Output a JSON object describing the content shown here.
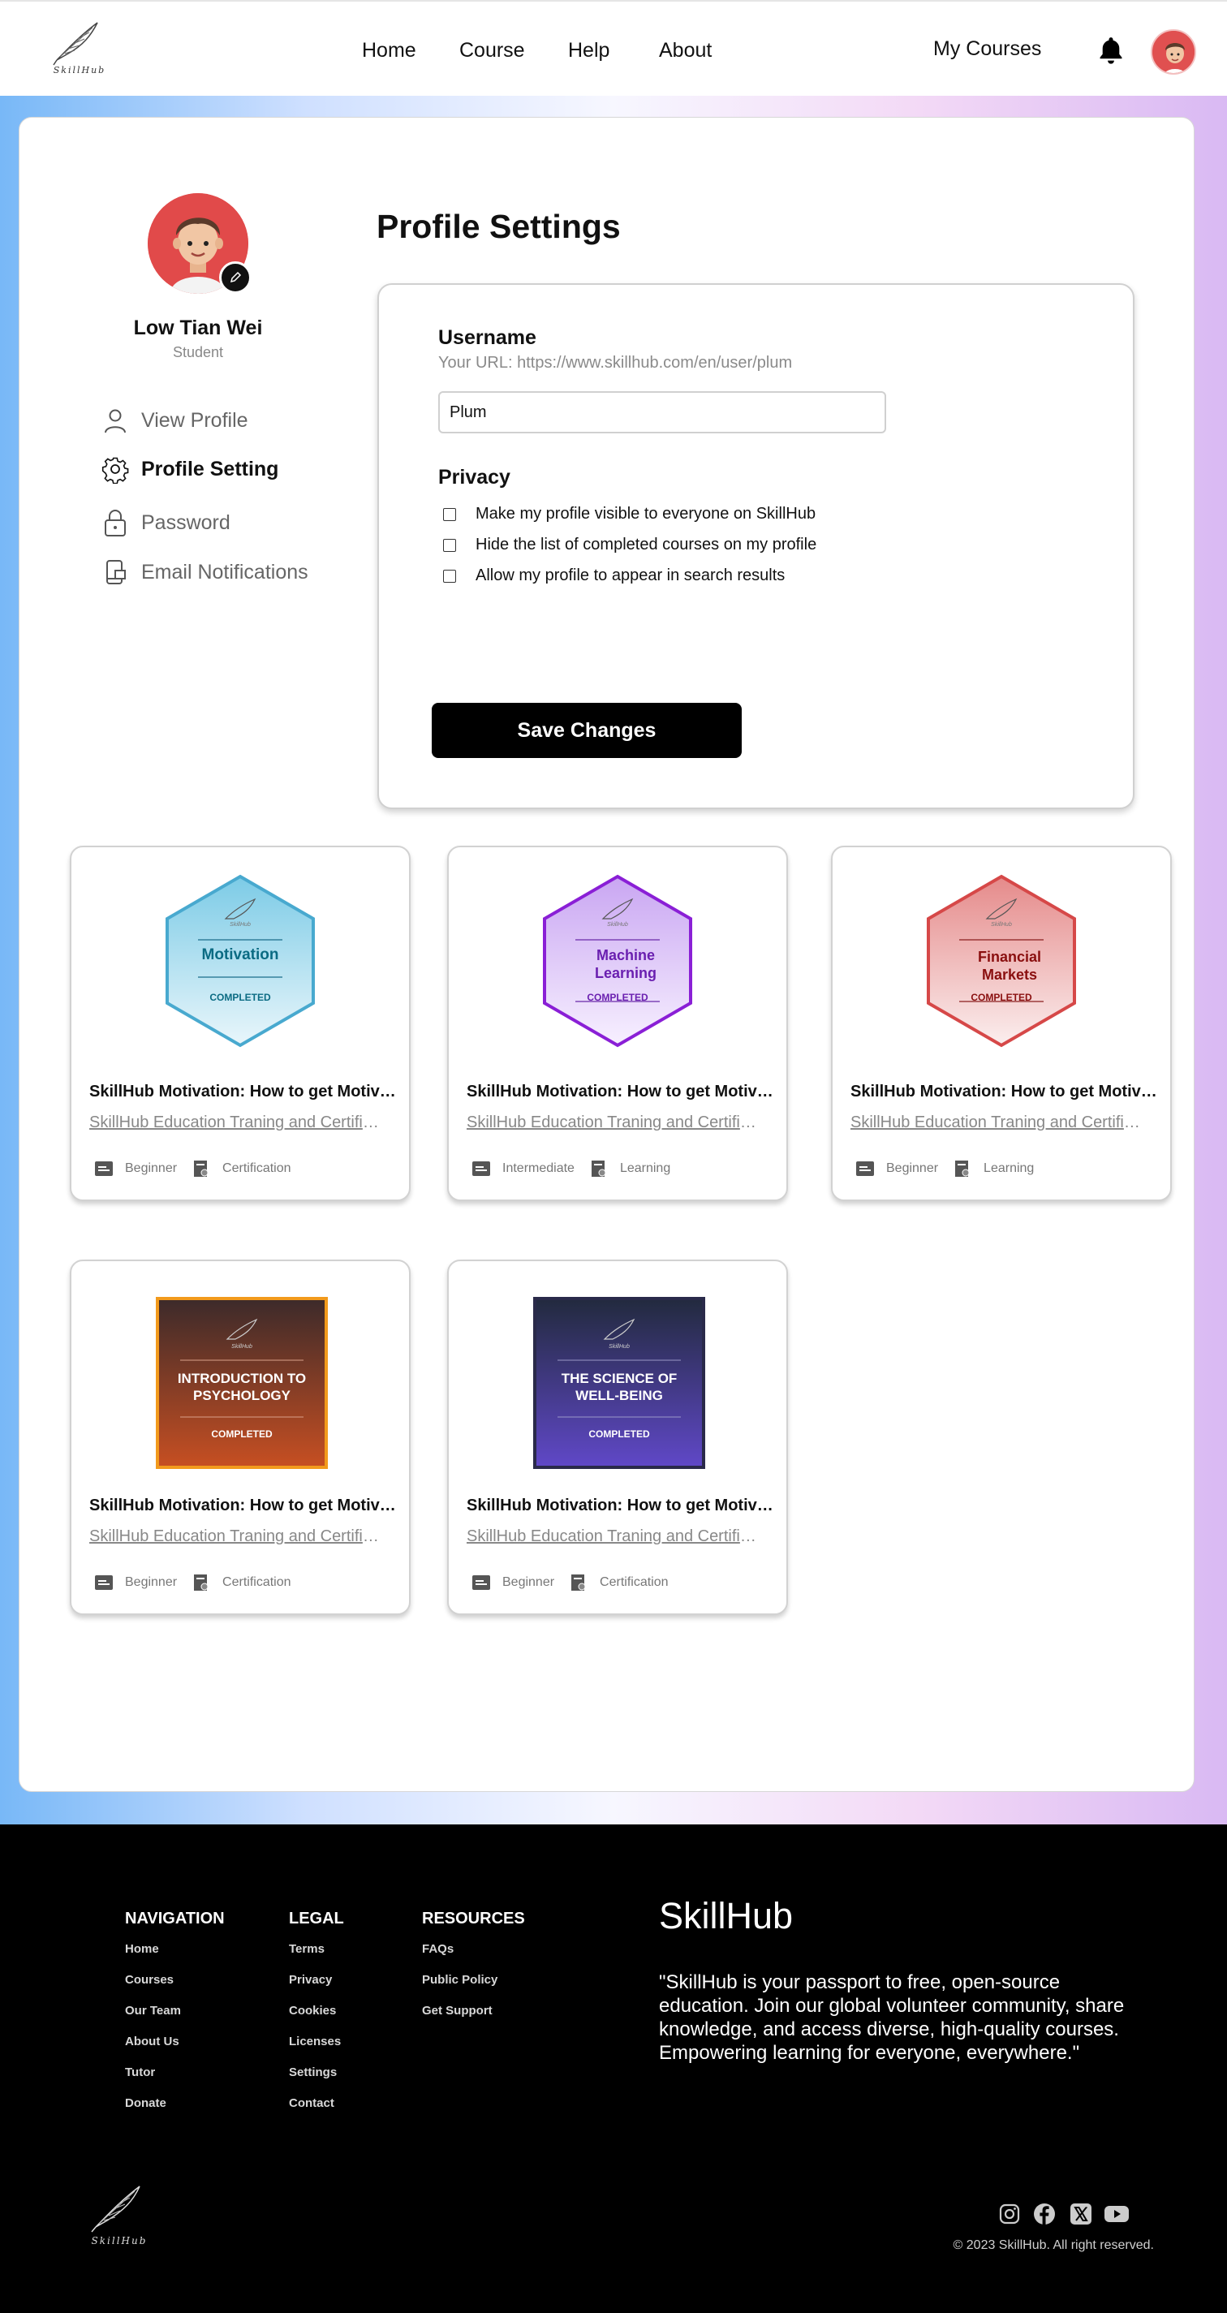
{
  "header": {
    "logo_text": "SkillHub",
    "nav": [
      "Home",
      "Course",
      "Help",
      "About"
    ],
    "my_courses": "My Courses"
  },
  "profile": {
    "name": "Low Tian Wei",
    "role": "Student"
  },
  "sidebar": {
    "items": [
      {
        "label": "View Profile",
        "icon": "user-icon"
      },
      {
        "label": "Profile Setting",
        "icon": "gear-icon",
        "active": true
      },
      {
        "label": "Password",
        "icon": "lock-icon"
      },
      {
        "label": "Email Notifications",
        "icon": "notification-icon"
      }
    ]
  },
  "settings": {
    "title": "Profile Settings",
    "username_label": "Username",
    "url_hint": "Your URL: https://www.skillhub.com/en/user/plum",
    "username_value": "Plum",
    "privacy_label": "Privacy",
    "privacy_options": [
      "Make my profile visible to everyone on SkillHub",
      "Hide the list of completed courses on my profile",
      "Allow my profile to appear in search results"
    ],
    "save_label": "Save Changes"
  },
  "courses": [
    {
      "badge_title": "Motivation",
      "badge_status": "COMPLETED",
      "badge_color": "#4ab0d4",
      "title": "SkillHub Motivation: How to get Motivated",
      "provider": "SkillHub Education Traning and Certification",
      "level": "Beginner",
      "type": "Certification"
    },
    {
      "badge_title": "Machine Learning",
      "badge_status": "COMPLETED",
      "badge_color": "#8a2bd6",
      "title": "SkillHub Motivation: How to get Motivated",
      "provider": "SkillHub Education Traning and Certification",
      "level": "Intermediate",
      "type": "Learning"
    },
    {
      "badge_title": "Financial Markets",
      "badge_status": "COMPLETED",
      "badge_color": "#d64848",
      "title": "SkillHub Motivation: How to get Motivated",
      "provider": "SkillHub Education Traning and Certification",
      "level": "Beginner",
      "type": "Learning"
    },
    {
      "badge_title": "INTRODUCTION TO PSYCHOLOGY",
      "badge_status": "COMPLETED",
      "badge_color": "#f29a1c",
      "title": "SkillHub Motivation: How to get Motivated",
      "provider": "SkillHub Education Traning and Certification",
      "level": "Beginner",
      "type": "Certification"
    },
    {
      "badge_title": "THE SCIENCE OF WELL-BEING",
      "badge_status": "COMPLETED",
      "badge_color": "#5848c8",
      "title": "SkillHub Motivation: How to get Motivated",
      "provider": "SkillHub Education Traning and Certification",
      "level": "Beginner",
      "type": "Certification"
    }
  ],
  "footer": {
    "navigation": {
      "heading": "NAVIGATION",
      "links": [
        "Home",
        "Courses",
        "Our Team",
        "About Us",
        "Tutor",
        "Donate"
      ]
    },
    "legal": {
      "heading": "LEGAL",
      "links": [
        "Terms",
        "Privacy",
        "Cookies",
        "Licenses",
        "Settings",
        "Contact"
      ]
    },
    "resources": {
      "heading": "RESOURCES",
      "links": [
        "FAQs",
        "Public Policy",
        "Get Support"
      ]
    },
    "brand": "SkillHub",
    "description": "\"SkillHub is your passport to free, open-source education. Join our global volunteer community, share knowledge, and access diverse, high-quality courses. Empowering learning for everyone, everywhere.\"",
    "social": [
      "instagram-icon",
      "facebook-icon",
      "x-icon",
      "youtube-icon"
    ],
    "copyright": "© 2023 SkillHub. All right reserved."
  }
}
